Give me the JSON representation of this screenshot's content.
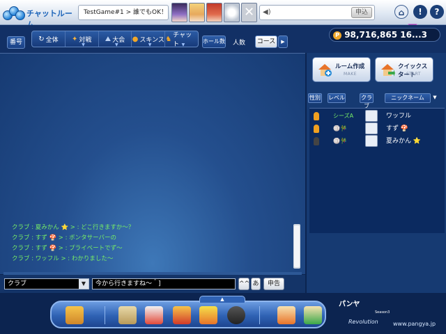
{
  "topbar": {
    "logo_title": "チャットルーム",
    "game_info": "TestGame#1 > 誰でもOK！1",
    "message_placeholder": "",
    "send_label": "申込",
    "avatar_x": "✕"
  },
  "toolbar": {
    "number_label": "番号",
    "tabs": [
      {
        "label": "全体",
        "icon": "refresh-icon"
      },
      {
        "label": "対戦",
        "icon": "versus-icon"
      },
      {
        "label": "大会",
        "icon": "tournament-icon"
      },
      {
        "label": "スキンス",
        "icon": "skins-icon"
      },
      {
        "label": "チャット",
        "icon": "chat-icon"
      }
    ],
    "hole_count_label": "ホール数",
    "players_label": "人数",
    "course_label": "コース",
    "arrow_label": "▶"
  },
  "money": {
    "amount": "98,716,865",
    "extra": "16...3",
    "coin_icon": "P"
  },
  "chat": {
    "lines": [
      "クラブ : 夏みかん ⭐ > : どこ行きますか～？",
      "クラブ : すず 🍄 > : ボンタサーバーの",
      "クラブ : すず 🍄 > : プライベートでず～",
      "クラブ : ワッフル > : わかりました～"
    ],
    "channel_value": "クラブ",
    "input_value": "今から行きますね～＾]",
    "emoticon_label": "^^",
    "ime_label": "あ",
    "report_label": "申告"
  },
  "right_panel": {
    "create_room_label": "ルーム作成",
    "create_room_sub": "MAKE",
    "quick_start_label": "クイックスタート",
    "quick_start_sub": "START",
    "headers": {
      "gender": "性別",
      "level": "レベル",
      "club": "クラブ",
      "nickname": "ニックネーム"
    },
    "players": [
      {
        "gender_color": "#f0a020",
        "club": "シーズA",
        "name": "ワッフル"
      },
      {
        "gender_color": "#f0a020",
        "club": "🏐🎋",
        "name": "すず 🍄"
      },
      {
        "gender_color": "#444444",
        "club": "🏐🎋",
        "name": "夏みかん ⭐"
      }
    ]
  },
  "dock": {
    "tab_label": "▲",
    "brand_title": "パンヤ",
    "brand_revolution": "Revolution",
    "brand_season": "Season3",
    "site": "www.pangya.jp",
    "icons": [
      "exit-icon",
      "shop-icon",
      "gift-icon",
      "present-icon",
      "scratch-icon",
      "cat-icon",
      "house-icon",
      "house-transfer-icon"
    ]
  }
}
